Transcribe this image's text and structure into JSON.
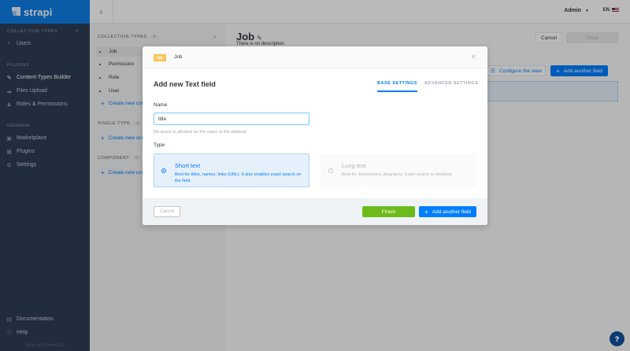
{
  "brand": {
    "name": "strapi"
  },
  "leftnav": {
    "collection_types_title": "COLLECTION TYPES",
    "collection_types": [
      {
        "label": "Users",
        "icon": "dot-icon"
      }
    ],
    "plugins_title": "PLUGINS",
    "plugins": [
      {
        "label": "Content-Types Builder",
        "icon": "paint-brush-icon"
      },
      {
        "label": "Files Upload",
        "icon": "cloud-upload-icon"
      },
      {
        "label": "Roles & Permissions",
        "icon": "users-icon"
      }
    ],
    "general_title": "GENERAL",
    "general": [
      {
        "label": "Marketplace",
        "icon": "shopping-basket-icon"
      },
      {
        "label": "Plugins",
        "icon": "puzzle-icon"
      },
      {
        "label": "Settings",
        "icon": "gear-icon"
      }
    ],
    "bottom": [
      {
        "label": "Documentation",
        "icon": "book-icon"
      },
      {
        "label": "Help",
        "icon": "question-icon"
      }
    ],
    "version": "Strapi v3.0.0-beta.19.3"
  },
  "header": {
    "user": "Admin",
    "language": "EN"
  },
  "submenu": {
    "collection_types_title": "COLLECTION TYPES",
    "collection_types_count": "4",
    "collection_types": [
      "Job",
      "Permission",
      "Role",
      "User"
    ],
    "create_collection": "Create new coll",
    "single_type_title": "SINGLE TYPE",
    "single_type_count": "0",
    "create_single": "Create new sing",
    "component_title": "COMPONENT",
    "component_count": "0",
    "create_component": "Create new com"
  },
  "main": {
    "title": "Job",
    "description": "There is no description",
    "cancel": "Cancel",
    "save": "Save",
    "configure_view": "Configure the view",
    "add_another_field": "Add another field"
  },
  "modal": {
    "badge": "Ab",
    "breadcrumb": "Job",
    "title": "Add new Text field",
    "tabs": {
      "base": "BASE SETTINGS",
      "advanced": "ADVANCED SETTINGS"
    },
    "name_label": "Name",
    "name_value": "title",
    "name_hint": "No space is allowed for the name of the attribute",
    "type_label": "Type",
    "short_text": {
      "name": "Short text",
      "desc": "Best for titles, names, links (URL). It also enables exact search on the field."
    },
    "long_text": {
      "name": "Long text",
      "desc": "Best for descriptions, biography. Exact search is disabled."
    },
    "cancel": "Cancel",
    "finish": "Finish",
    "add_another_field": "Add another field"
  }
}
